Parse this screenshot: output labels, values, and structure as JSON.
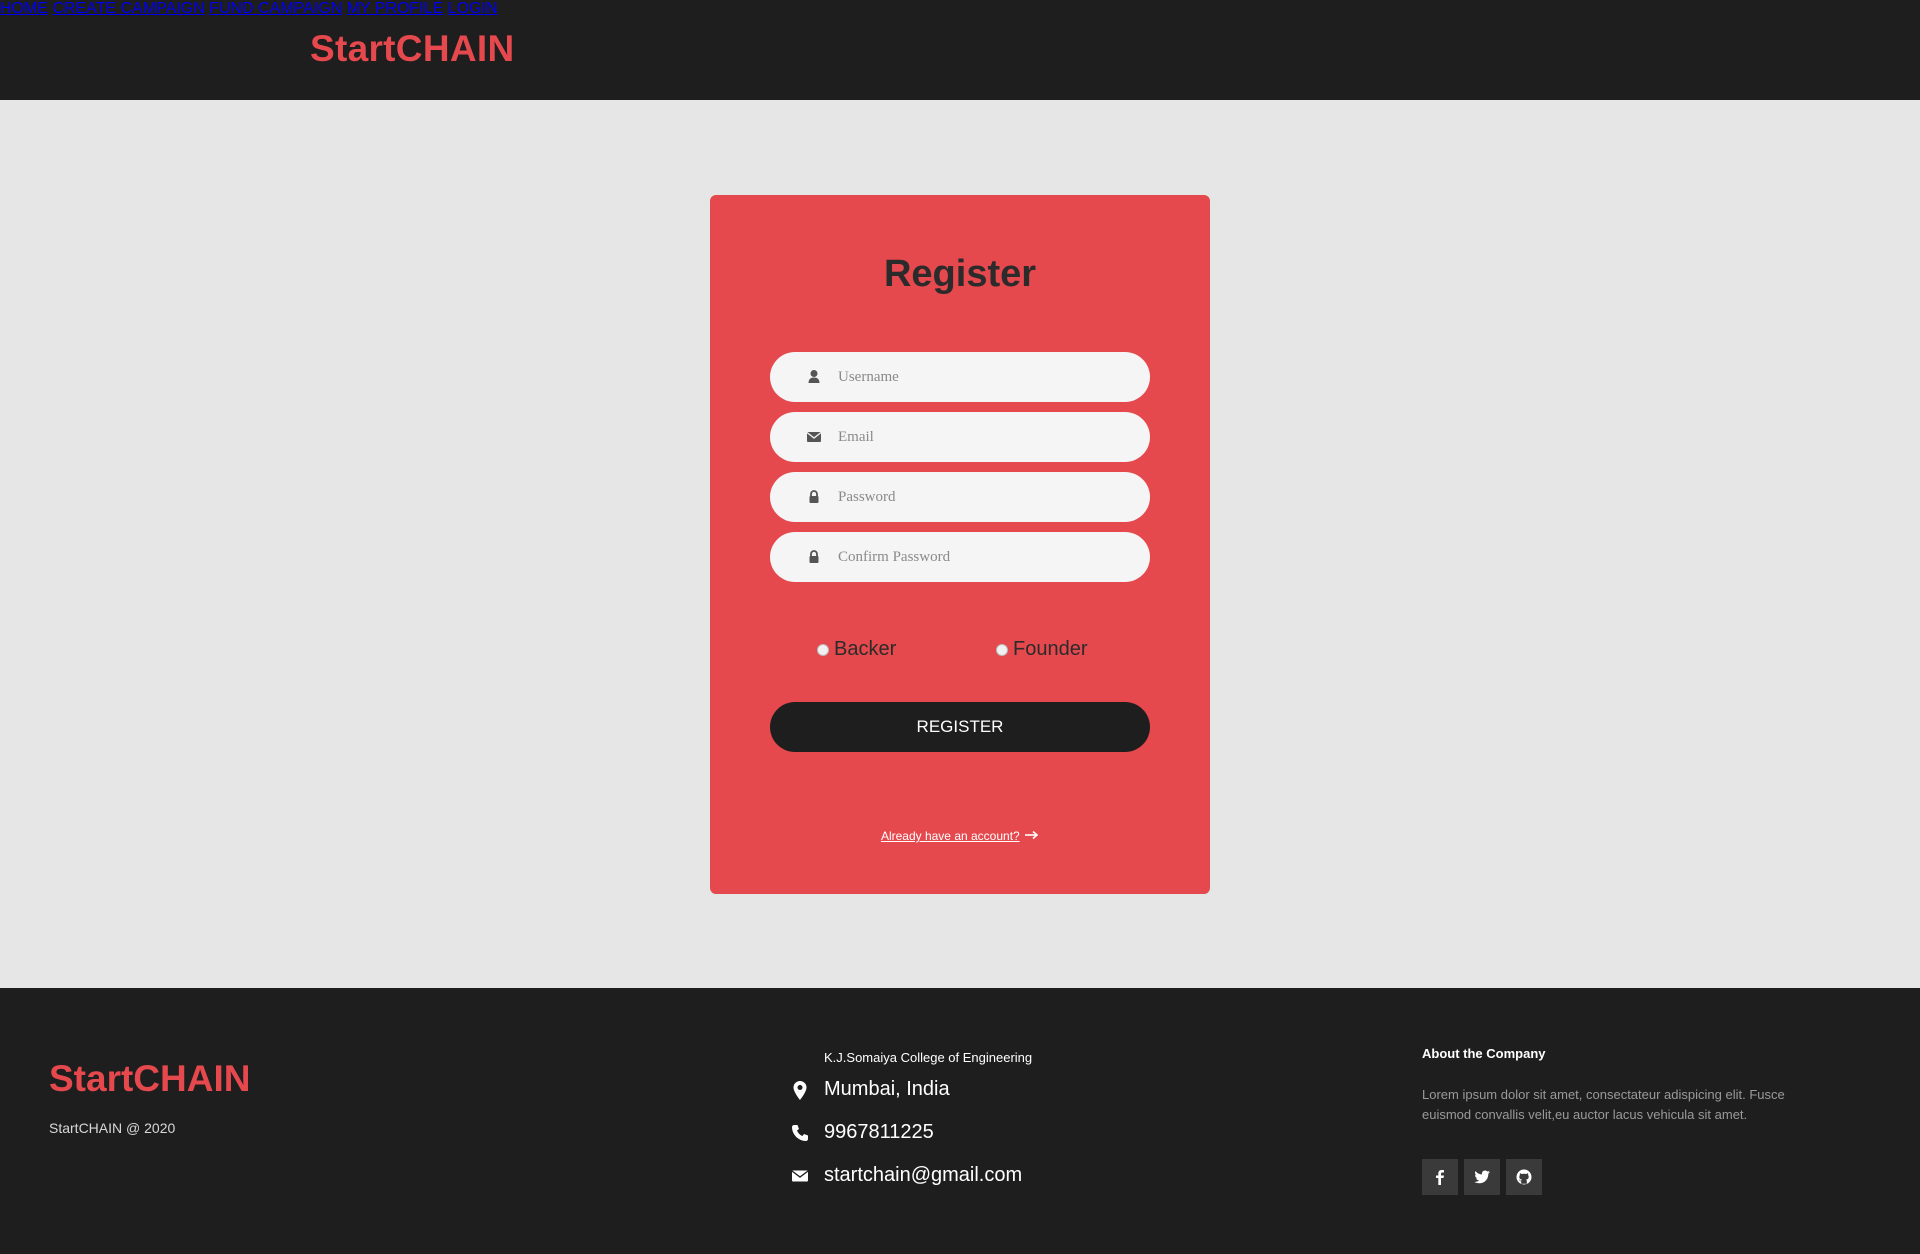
{
  "header": {
    "brand": "StartCHAIN",
    "nav": [
      {
        "label": "HOME"
      },
      {
        "label": "CREATE CAMPAIGN"
      },
      {
        "label": "FUND CAMPAIGN"
      },
      {
        "label": "MY PROFILE"
      },
      {
        "label": "LOGIN"
      }
    ]
  },
  "register": {
    "title": "Register",
    "fields": [
      {
        "placeholder": "Username",
        "icon": "user-icon",
        "value": ""
      },
      {
        "placeholder": "Email",
        "icon": "envelope-icon",
        "value": ""
      },
      {
        "placeholder": "Password",
        "icon": "lock-icon",
        "value": ""
      },
      {
        "placeholder": "Confirm Password",
        "icon": "lock-icon",
        "value": ""
      }
    ],
    "roles": [
      {
        "label": "Backer",
        "selected": false
      },
      {
        "label": "Founder",
        "selected": false
      }
    ],
    "button": "REGISTER",
    "login_link": "Already have an account?"
  },
  "footer": {
    "brand": "StartCHAIN",
    "copyright": "StartCHAIN @ 2020",
    "college": "K.J.Somaiya College of Engineering",
    "city": "Mumbai, India",
    "phone": "9967811225",
    "email": "startchain@gmail.com",
    "about_heading": "About the Company",
    "about_text": "Lorem ipsum dolor sit amet, consectateur adispicing elit. Fusce euismod convallis velit,eu auctor lacus vehicula sit amet.",
    "socials": [
      "facebook-icon",
      "twitter-icon",
      "github-icon"
    ]
  },
  "colors": {
    "accent": "#e5484d",
    "dark": "#1e1e1e",
    "page_bg": "#e6e6e6"
  }
}
